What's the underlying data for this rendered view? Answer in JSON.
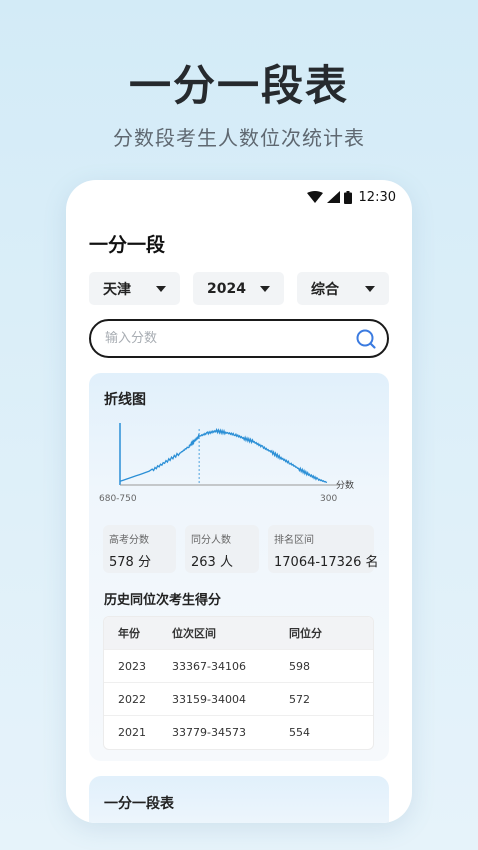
{
  "promo": {
    "title": "一分一段表",
    "subtitle": "分数段考生人数位次统计表"
  },
  "status_bar": {
    "time": "12:30",
    "icons": [
      "wifi-icon",
      "signal-icon",
      "battery-icon"
    ]
  },
  "app": {
    "title": "一分一段"
  },
  "filters": [
    {
      "label": "天津",
      "icon": "caret-down-icon"
    },
    {
      "label": "2024",
      "icon": "caret-down-icon"
    },
    {
      "label": "综合",
      "icon": "caret-down-icon"
    }
  ],
  "search": {
    "placeholder": "输入分数",
    "value": "",
    "icon": "search-icon",
    "icon_color": "#3b7be0"
  },
  "line_chart_card": {
    "title": "折线图",
    "x_start_label": "680-750",
    "x_end_label": "300",
    "axis_unit": "分数"
  },
  "chart_data": {
    "type": "line",
    "title": "折线图",
    "xlabel": "分数",
    "ylabel": "",
    "x_tick_labels": [
      "680-750",
      "300"
    ],
    "x_range": [
      750,
      300
    ],
    "series": [
      {
        "color": "#2b8fd6",
        "x": [
          750,
          680,
          650,
          620,
          600,
          590,
          578,
          560,
          540,
          520,
          500,
          480,
          460,
          440,
          420,
          400,
          380,
          360,
          340,
          320,
          300
        ],
        "y": [
          0.05,
          0.26,
          0.42,
          0.58,
          0.71,
          0.8,
          0.9,
          0.96,
          1.0,
          0.97,
          0.93,
          0.86,
          0.8,
          0.7,
          0.6,
          0.49,
          0.39,
          0.28,
          0.18,
          0.09,
          0.03
        ]
      }
    ],
    "marker": {
      "x": 578,
      "style": "dashed"
    },
    "grid": false
  },
  "stats": [
    {
      "label": "高考分数",
      "value": "578 分"
    },
    {
      "label": "同分人数",
      "value": "263 人"
    },
    {
      "label": "排名区间",
      "value": "17064-17326 名"
    }
  ],
  "history": {
    "title": "历史同位次考生得分",
    "columns": [
      "年份",
      "位次区间",
      "同位分"
    ],
    "rows": [
      [
        "2023",
        "33367-34106",
        "598"
      ],
      [
        "2022",
        "33159-34004",
        "572"
      ],
      [
        "2021",
        "33779-34573",
        "554"
      ]
    ]
  },
  "table_card": {
    "title": "一分一段表"
  }
}
